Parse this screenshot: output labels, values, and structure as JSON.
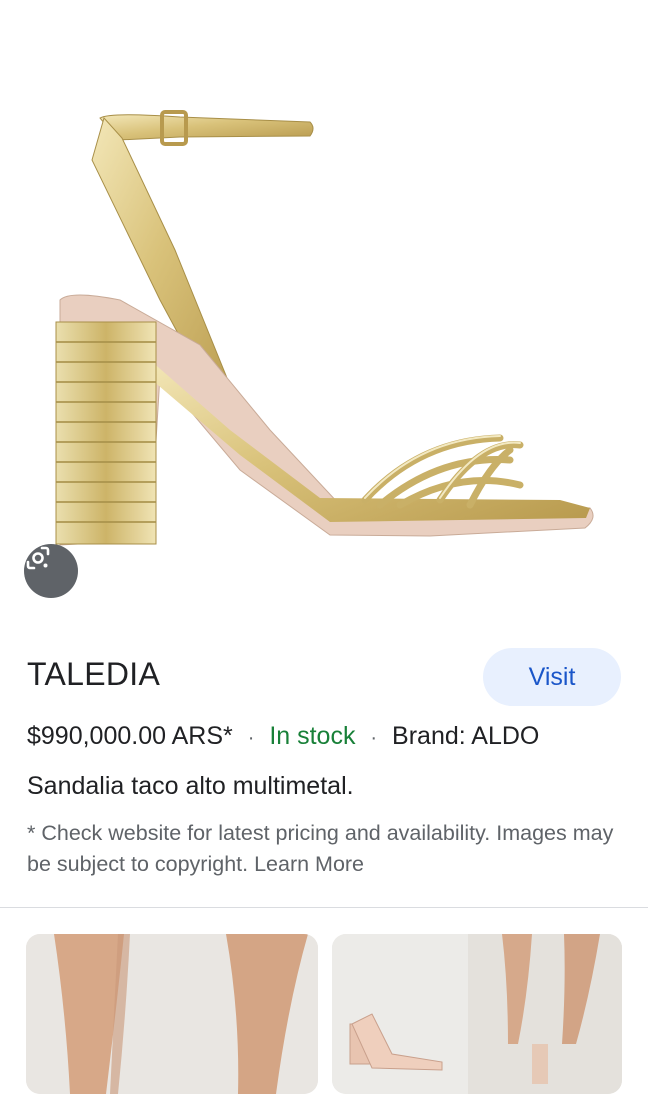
{
  "product": {
    "title": "TALEDIA",
    "visit_label": "Visit",
    "price": "$990,000.00 ARS*",
    "separator": "·",
    "stock": "In stock",
    "brand": "Brand: ALDO",
    "description": "Sandalia taco alto multimetal.",
    "disclaimer": "* Check website for latest pricing and availability. Images may be subject to copyright. Learn More"
  },
  "icons": {
    "lens": "google-lens-icon"
  },
  "colors": {
    "in_stock": "#188038",
    "visit_bg": "#e8f0fe",
    "visit_text": "#1a56c9"
  }
}
